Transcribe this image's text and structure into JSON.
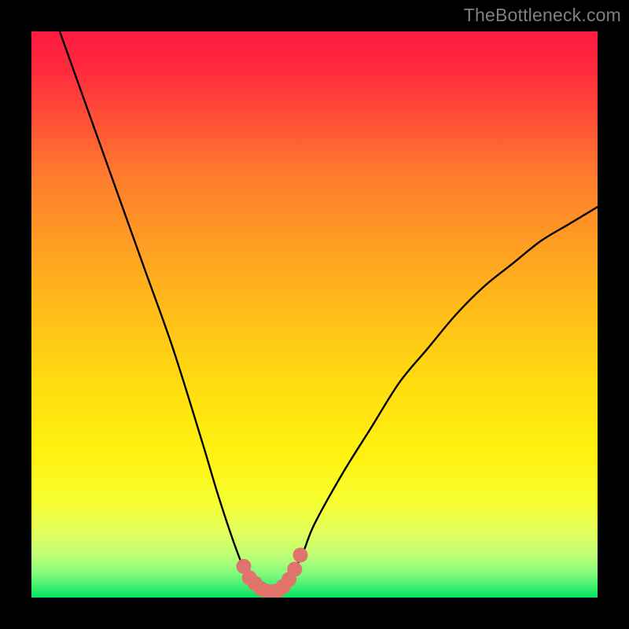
{
  "watermark": "TheBottleneck.com",
  "colors": {
    "background": "#000000",
    "gradient_top": "#ff1b40",
    "gradient_mid": "#ffdc0f",
    "gradient_bottom": "#00e562",
    "curve": "#000000",
    "marker_fill": "#e0746d",
    "marker_stroke": "#e0746d"
  },
  "chart_data": {
    "type": "line",
    "title": "",
    "xlabel": "",
    "ylabel": "",
    "xlim": [
      0,
      100
    ],
    "ylim": [
      0,
      100
    ],
    "grid": false,
    "legend": false,
    "series": [
      {
        "name": "bottleneck-curve",
        "x": [
          5,
          10,
          15,
          20,
          25,
          30,
          33,
          36,
          38,
          39,
          40,
          41,
          42,
          43,
          44,
          45,
          46,
          48,
          50,
          55,
          60,
          65,
          70,
          75,
          80,
          85,
          90,
          95,
          100
        ],
        "y": [
          100,
          86,
          72,
          58,
          44,
          28,
          18,
          9,
          4,
          2.5,
          1.5,
          1,
          1,
          1,
          1.2,
          2,
          4,
          8,
          13,
          22,
          30,
          38,
          44,
          50,
          55,
          59,
          63,
          66,
          69
        ]
      }
    ],
    "markers": {
      "name": "optimal-region",
      "x": [
        37.5,
        38.5,
        39.5,
        40.5,
        41.5,
        42.5,
        43.5,
        44.5,
        45.5,
        46.5,
        47.5
      ],
      "y": [
        5.5,
        3.5,
        2.5,
        1.6,
        1.1,
        1.0,
        1.2,
        2.0,
        3.2,
        5.0,
        7.5
      ]
    },
    "gradient_stops": [
      {
        "offset": 0.0,
        "color": "#ff1b40"
      },
      {
        "offset": 0.07,
        "color": "#ff2b3d"
      },
      {
        "offset": 0.25,
        "color": "#ff7a2e"
      },
      {
        "offset": 0.45,
        "color": "#ffb21c"
      },
      {
        "offset": 0.62,
        "color": "#ffdc0f"
      },
      {
        "offset": 0.75,
        "color": "#fff210"
      },
      {
        "offset": 0.83,
        "color": "#f7ff30"
      },
      {
        "offset": 0.89,
        "color": "#e0ff60"
      },
      {
        "offset": 0.93,
        "color": "#b8ff78"
      },
      {
        "offset": 0.96,
        "color": "#7cf97a"
      },
      {
        "offset": 0.985,
        "color": "#34ed6f"
      },
      {
        "offset": 1.0,
        "color": "#00e562"
      }
    ]
  }
}
